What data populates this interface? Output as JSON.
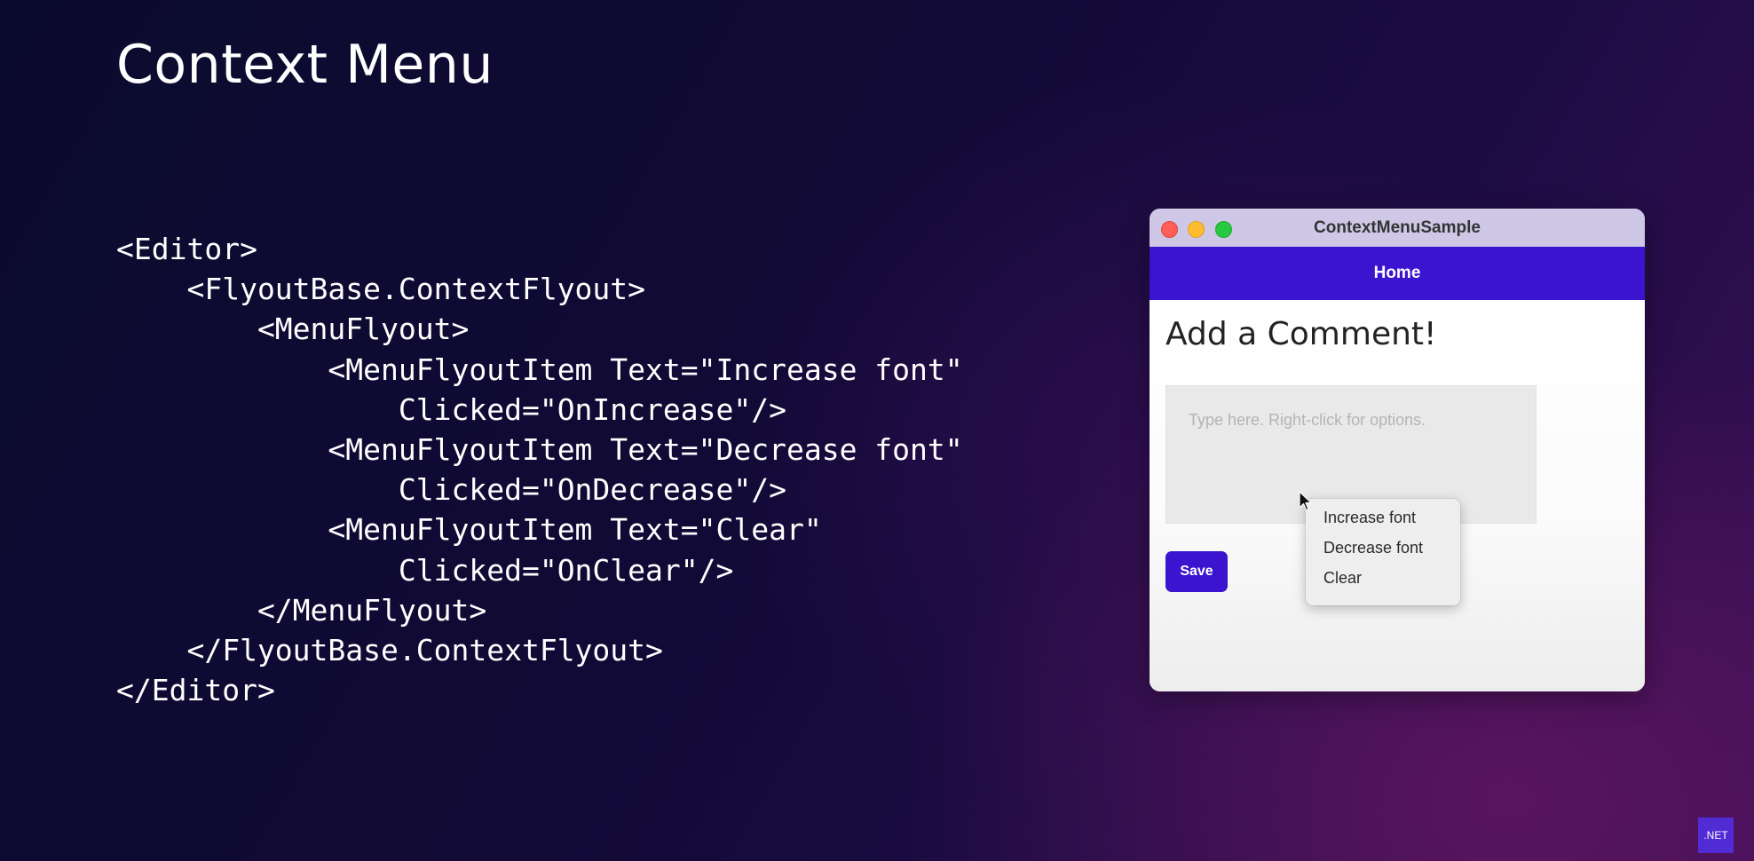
{
  "slide": {
    "title": "Context Menu",
    "code_lines": [
      "<Editor>",
      "    <FlyoutBase.ContextFlyout>",
      "        <MenuFlyout>",
      "            <MenuFlyoutItem Text=\"Increase font\"",
      "                Clicked=\"OnIncrease\"/>",
      "            <MenuFlyoutItem Text=\"Decrease font\"",
      "                Clicked=\"OnDecrease\"/>",
      "            <MenuFlyoutItem Text=\"Clear\"",
      "                Clicked=\"OnClear\"/>",
      "        </MenuFlyout>",
      "    </FlyoutBase.ContextFlyout>",
      "</Editor>"
    ]
  },
  "window": {
    "title": "ContextMenuSample",
    "traffic_lights": [
      "close-icon",
      "minimize-icon",
      "zoom-icon"
    ]
  },
  "nav": {
    "title": "Home"
  },
  "page": {
    "heading": "Add a Comment!",
    "editor_placeholder": "Type here. Right-click for options.",
    "save_label": "Save"
  },
  "context_menu": {
    "items": [
      {
        "label": "Increase font"
      },
      {
        "label": "Decrease font"
      },
      {
        "label": "Clear"
      }
    ]
  },
  "badge": {
    "label": ".NET"
  },
  "colors": {
    "accent": "#3a14cf",
    "dotnet_brand": "#512bd4",
    "titlebar": "#cfc7e6"
  }
}
